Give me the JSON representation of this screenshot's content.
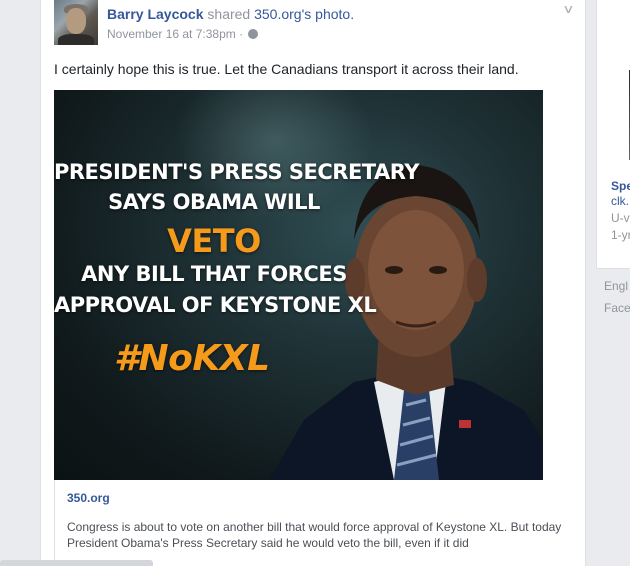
{
  "post": {
    "author": "Barry Laycock",
    "action_text": "shared",
    "shared_source": "350.org's",
    "shared_object": "photo.",
    "timestamp": "November 16 at 7:38pm",
    "privacy_separator": "·",
    "privacy_icon": "globe-icon",
    "menu_icon": "chevron-down-icon",
    "message": "I certainly hope this is true. Let the Canadians transport it across their land."
  },
  "photo": {
    "line1": "PRESIDENT'S PRESS SECRETARY",
    "line2": "SAYS OBAMA  WILL",
    "line3": "VETO",
    "line4": "ANY BILL THAT FORCES",
    "line5": "APPROVAL OF KEYSTONE XL",
    "hashtag": "#NoKXL",
    "accent_color": "#f59a1b"
  },
  "attachment": {
    "source": "350.org",
    "description": "Congress is about to vote on another bill that would force approval of Keystone XL. But today President Obama's Press Secretary said he would veto the bill, even if it did"
  },
  "right_panel": {
    "line1": "Spe",
    "line2": "clk.",
    "line3": "U-v",
    "line4": "1-yr"
  },
  "footer": {
    "line1": "Engl",
    "line2": "Face"
  },
  "colors": {
    "link": "#365899",
    "meta": "#90949c",
    "background": "#e9ebee"
  }
}
